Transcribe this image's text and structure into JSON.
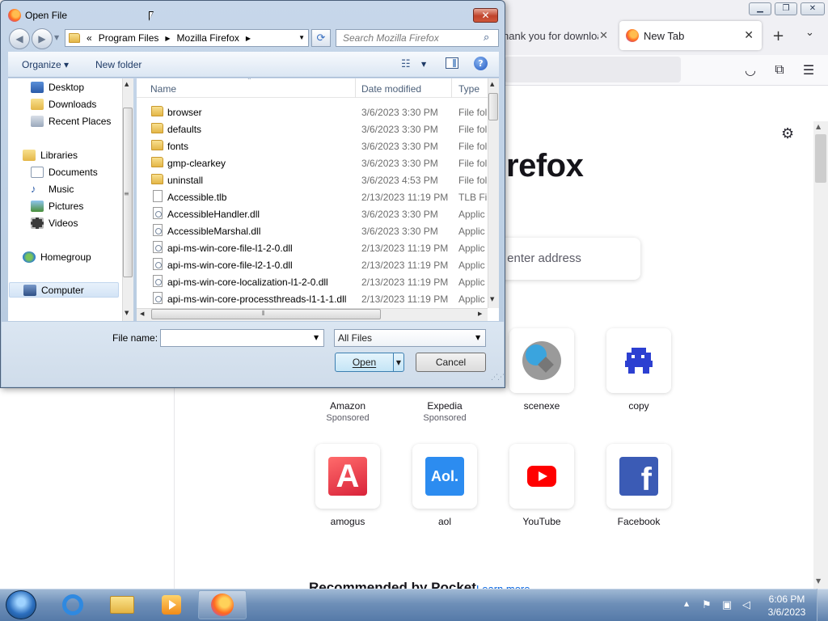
{
  "browser": {
    "tabs": [
      {
        "label": "hank you for downloa"
      },
      {
        "label": "New Tab"
      }
    ],
    "new_tab_symbol": "+",
    "tab_close_symbol": "✕",
    "wordmark": "refox",
    "search_placeholder": "r enter address",
    "shortcuts": [
      {
        "label": "Amazon",
        "sub": "Sponsored"
      },
      {
        "label": "Expedia",
        "sub": "Sponsored"
      },
      {
        "label": "scenexe",
        "sub": ""
      },
      {
        "label": "copy",
        "sub": ""
      },
      {
        "label": "amogus",
        "sub": ""
      },
      {
        "label": "aol",
        "sub": ""
      },
      {
        "label": "YouTube",
        "sub": ""
      },
      {
        "label": "Facebook",
        "sub": ""
      }
    ],
    "logos": {
      "amogus_letter": "A",
      "aol_text": "Aol.",
      "facebook_letter": "f"
    },
    "pocket": {
      "heading": "Recommended by Pocket",
      "learn_more": "Learn more"
    }
  },
  "dialog": {
    "title": "Open File",
    "close_symbol": "✕",
    "address": {
      "overflow": "«",
      "crumbs": [
        "Program Files",
        "Mozilla Firefox"
      ]
    },
    "search_placeholder": "Search Mozilla Firefox",
    "toolbar": {
      "organize": "Organize ▾",
      "new_folder": "New folder",
      "help": "?"
    },
    "nav": {
      "desktop": "Desktop",
      "downloads": "Downloads",
      "recent": "Recent Places",
      "libraries": "Libraries",
      "documents": "Documents",
      "music": "Music",
      "pictures": "Pictures",
      "videos": "Videos",
      "homegroup": "Homegroup",
      "computer": "Computer"
    },
    "columns": {
      "name": "Name",
      "date": "Date modified",
      "type": "Type"
    },
    "files": [
      {
        "name": "browser",
        "date": "3/6/2023 3:30 PM",
        "type": "File fol",
        "kind": "folder"
      },
      {
        "name": "defaults",
        "date": "3/6/2023 3:30 PM",
        "type": "File fol",
        "kind": "folder"
      },
      {
        "name": "fonts",
        "date": "3/6/2023 3:30 PM",
        "type": "File fol",
        "kind": "folder"
      },
      {
        "name": "gmp-clearkey",
        "date": "3/6/2023 3:30 PM",
        "type": "File fol",
        "kind": "folder"
      },
      {
        "name": "uninstall",
        "date": "3/6/2023 4:53 PM",
        "type": "File fol",
        "kind": "folder"
      },
      {
        "name": "Accessible.tlb",
        "date": "2/13/2023 11:19 PM",
        "type": "TLB Fil",
        "kind": "doc"
      },
      {
        "name": "AccessibleHandler.dll",
        "date": "3/6/2023 3:30 PM",
        "type": "Applic",
        "kind": "dll"
      },
      {
        "name": "AccessibleMarshal.dll",
        "date": "3/6/2023 3:30 PM",
        "type": "Applic",
        "kind": "dll"
      },
      {
        "name": "api-ms-win-core-file-l1-2-0.dll",
        "date": "2/13/2023 11:19 PM",
        "type": "Applic",
        "kind": "dll"
      },
      {
        "name": "api-ms-win-core-file-l2-1-0.dll",
        "date": "2/13/2023 11:19 PM",
        "type": "Applic",
        "kind": "dll"
      },
      {
        "name": "api-ms-win-core-localization-l1-2-0.dll",
        "date": "2/13/2023 11:19 PM",
        "type": "Applic",
        "kind": "dll"
      },
      {
        "name": "api-ms-win-core-processthreads-l1-1-1.dll",
        "date": "2/13/2023 11:19 PM",
        "type": "Applic",
        "kind": "dll"
      }
    ],
    "file_name_label": "File name:",
    "file_name_value": "",
    "filter": "All Files",
    "open_label": "Open",
    "cancel_label": "Cancel"
  },
  "taskbar": {
    "time": "6:06 PM",
    "date": "3/6/2023"
  }
}
